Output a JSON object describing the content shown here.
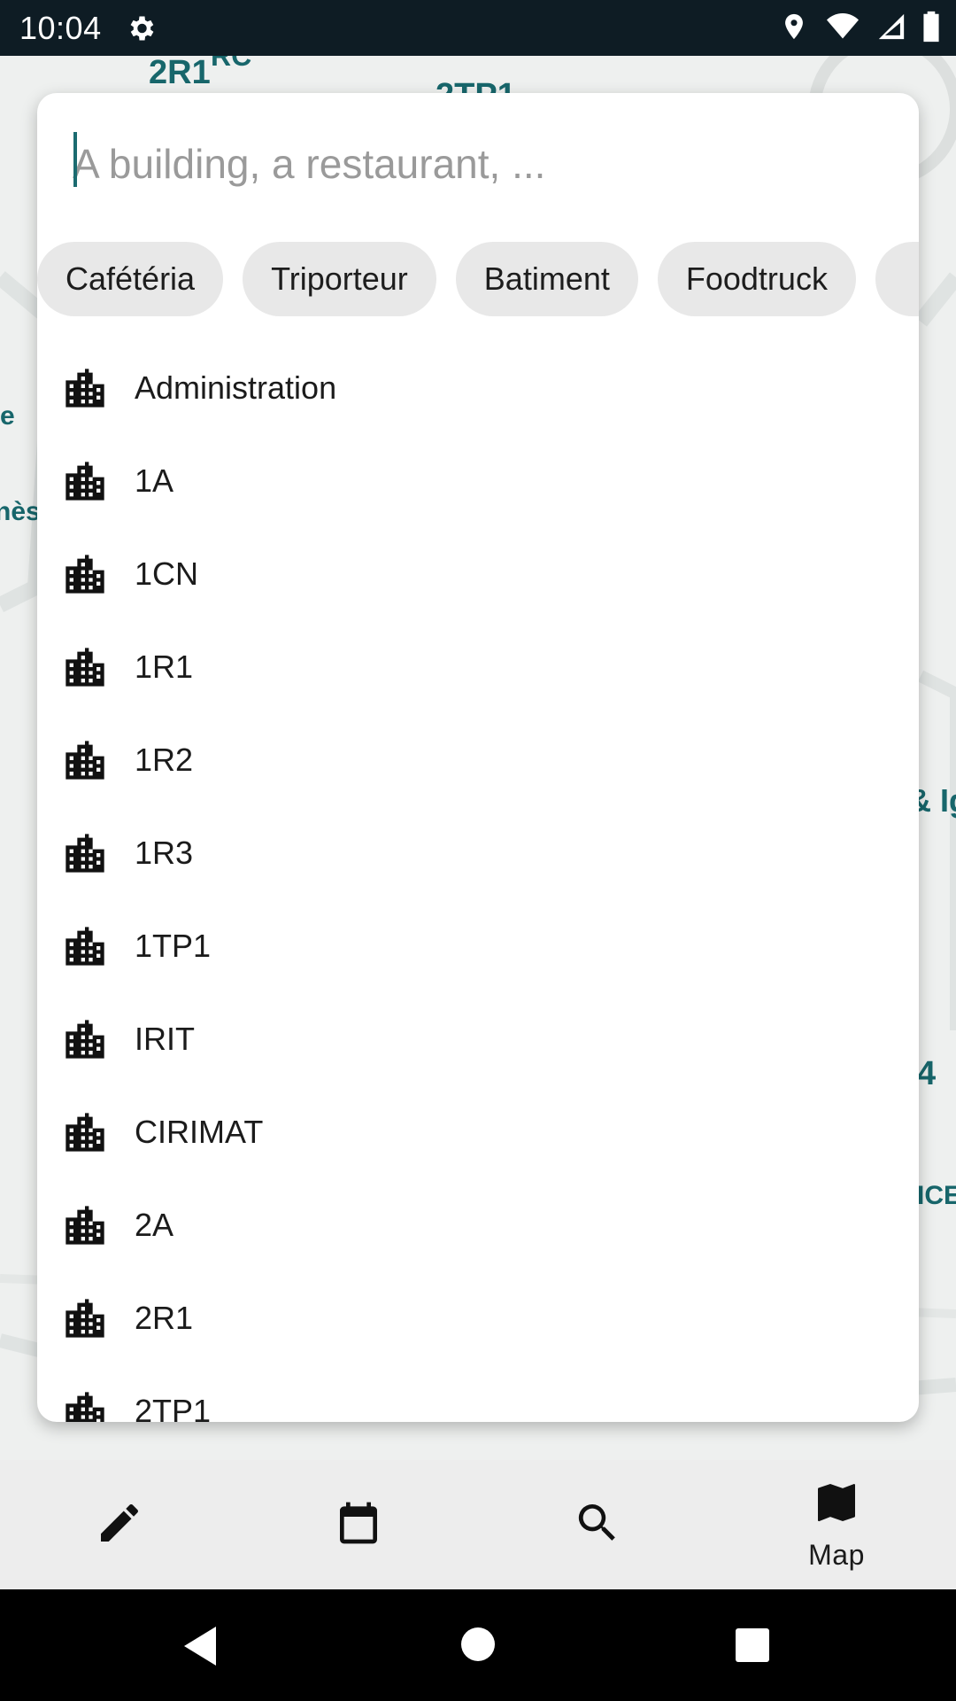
{
  "status_bar": {
    "time": "10:04",
    "icons": [
      "settings-icon",
      "location-icon",
      "wifi-icon",
      "signal-icon",
      "battery-icon"
    ]
  },
  "map": {
    "labels": [
      "2R1",
      "RC",
      "2TP1",
      "e",
      "nès",
      "& Ig",
      "4",
      "ICE"
    ]
  },
  "search": {
    "placeholder": "A building, a restaurant, ..."
  },
  "filters": {
    "chips": [
      "Cafétéria",
      "Triporteur",
      "Batiment",
      "Foodtruck",
      ""
    ]
  },
  "results": {
    "icon": "building-icon",
    "items": [
      "Administration",
      "1A",
      "1CN",
      "1R1",
      "1R2",
      "1R3",
      "1TP1",
      "IRIT",
      "CIRIMAT",
      "2A",
      "2R1",
      "2TP1"
    ]
  },
  "bottom_nav": {
    "items": [
      {
        "icon": "edit-icon",
        "label": ""
      },
      {
        "icon": "calendar-icon",
        "label": ""
      },
      {
        "icon": "search-icon",
        "label": ""
      },
      {
        "icon": "map-icon",
        "label": "Map"
      }
    ]
  },
  "colors": {
    "accent": "#1b6b70",
    "status_bar": "#0e1c24",
    "nav_bg": "#ededed"
  }
}
